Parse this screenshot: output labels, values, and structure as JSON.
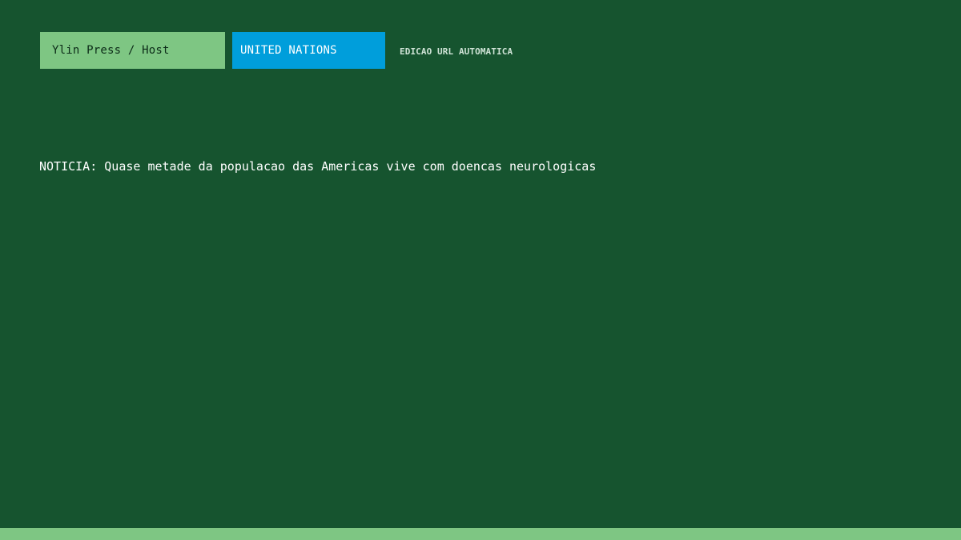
{
  "header": {
    "brand_label": "Ylin Press / Host",
    "source_label": "UNITED NATIONS",
    "edition_label": "EDICAO URL AUTOMATICA"
  },
  "main": {
    "headline": "NOTICIA: Quase metade da populacao das Americas vive com doencas neurologicas"
  },
  "colors": {
    "background": "#16542f",
    "brand_chip": "#7ec683",
    "source_chip": "#009edb",
    "text": "#ffffff",
    "bottom_strip": "#7ec683"
  }
}
